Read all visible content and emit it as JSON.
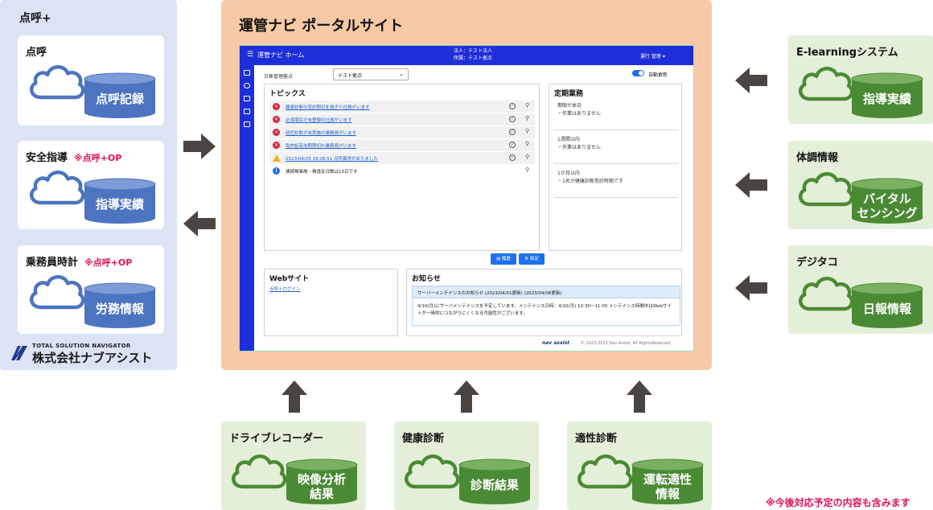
{
  "colors": {
    "left_bg": "#dce3f4",
    "portal_bg": "#f7c9a5",
    "green_bg": "#e3efd8",
    "blue_cylinder": "#4c74c0",
    "green_cylinder": "#4b8a34",
    "arrow": "#4a4541",
    "accent_red": "#e0105a",
    "app_blue": "#1d2fd9"
  },
  "left": {
    "title": "点呼+",
    "cards": [
      {
        "title": "点呼",
        "op": "",
        "db": "点呼記録"
      },
      {
        "title": "安全指導",
        "op": "※点呼+OP",
        "db": "指導実績"
      },
      {
        "title": "乗務員時計",
        "op": "※点呼+OP",
        "db": "労務情報"
      }
    ],
    "logo": {
      "small": "TOTAL SOLUTION NAVIGATOR",
      "main": "株式会社ナブアシスト"
    }
  },
  "portal": {
    "title": "運管ナビ ポータルサイト",
    "app": {
      "title": "運管ナビ ホーム",
      "corp_line1": "法人：テスト法人",
      "corp_line2": "所属：テスト拠点",
      "user": "運行 管理 ▾",
      "filter_label": "対象管理拠点",
      "filter_value": "テスト拠点",
      "auto_update": "自動更新",
      "topics_title": "トピックス",
      "topics": [
        {
          "type": "error",
          "text": "健康診断の受診期日を過ぎた社員がいます",
          "link": true
        },
        {
          "type": "error",
          "text": "必須項目が未登録の社員がいます",
          "link": true
        },
        {
          "type": "error",
          "text": "初任診断が未実施の乗務員がいます",
          "link": true
        },
        {
          "type": "error",
          "text": "免許証有効期限切れ乗務員がいます",
          "link": true
        },
        {
          "type": "warn",
          "text": "2023/04/20 18:28:51 点呼異常がありました",
          "link": true
        },
        {
          "type": "info",
          "text": "連続無事故・無違反日数は13日です",
          "link": false
        }
      ],
      "schedule_title": "定期業務",
      "schedule": [
        {
          "line1": "期限が本日",
          "line2": "・作業はありません"
        },
        {
          "line1": "1週間以内",
          "line2": "・作業はありません"
        },
        {
          "line1": "1か月以内",
          "line2": "・1名が健康診断受診時期です"
        }
      ],
      "btn_history": "▤ 履歴",
      "btn_settings": "⚙ 設定",
      "website_title": "Webサイト",
      "website_link": "点呼＋ログイン",
      "news_title": "お知らせ",
      "news_head": "サーバーメンテナンスのお知らせ (2023/04/01更新) (2023/04/06更新)",
      "news_body": "4/10(月)にサーバメンテナンスを予定しています。メンテナンス日時：4/10(月) 10:30〜11:00 メンテナンス時間中はWebサイトが一時的につながりにくくなる可能性がございます。",
      "footer_logo": "nav assist",
      "footer_copy": "© 2023-2023 Nav Assist. All RightsReserved."
    }
  },
  "right": [
    {
      "title": "E-learningシステム",
      "db": [
        "指導実績"
      ]
    },
    {
      "title": "体調情報",
      "db": [
        "バイタル",
        "センシング"
      ]
    },
    {
      "title": "デジタコ",
      "db": [
        "日報情報"
      ]
    }
  ],
  "bottom": [
    {
      "title": "ドライブレコーダー",
      "db": [
        "映像分析",
        "結果"
      ]
    },
    {
      "title": "健康診断",
      "db": [
        "診断結果"
      ]
    },
    {
      "title": "適性診断",
      "db": [
        "運転適性",
        "情報"
      ]
    }
  ],
  "note": "※今後対応予定の内容も含みます"
}
